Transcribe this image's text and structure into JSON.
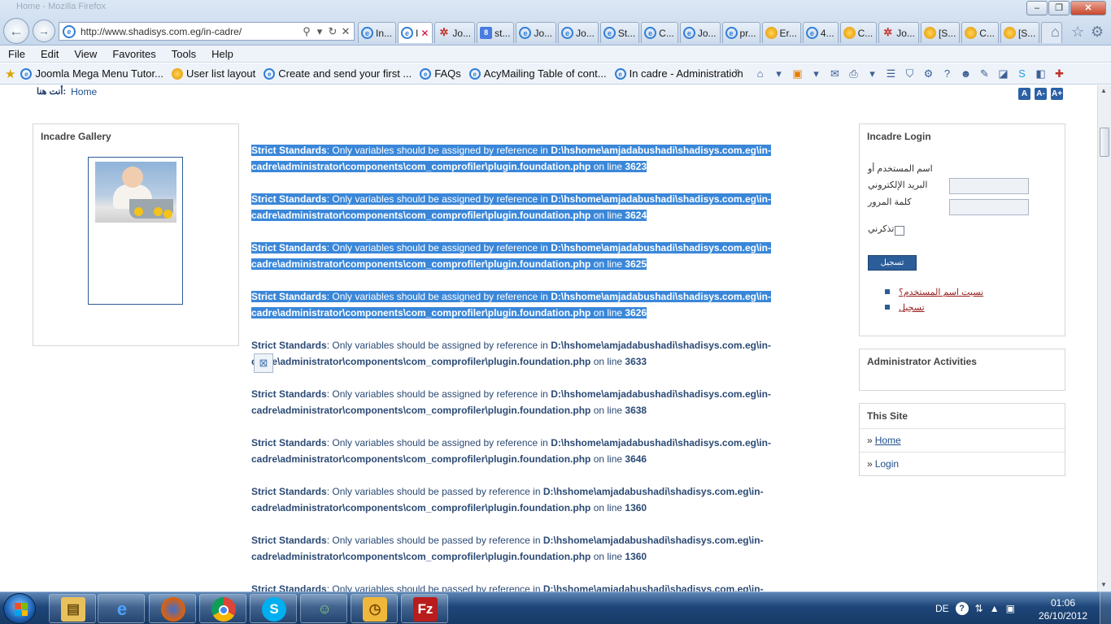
{
  "window": {
    "title": "Home - Mozilla Firefox"
  },
  "address_bar": {
    "url": "http://www.shadisys.com.eg/in-cadre/"
  },
  "tabs": [
    {
      "label": "In...",
      "icon": "ie",
      "active": false
    },
    {
      "label": "I",
      "icon": "ie",
      "active": true
    },
    {
      "label": "Jo...",
      "icon": "joomla",
      "active": false
    },
    {
      "label": "st...",
      "icon": "google",
      "active": false
    },
    {
      "label": "Jo...",
      "icon": "ie",
      "active": false
    },
    {
      "label": "Jo...",
      "icon": "ie",
      "active": false
    },
    {
      "label": "St...",
      "icon": "ie",
      "active": false
    },
    {
      "label": "C...",
      "icon": "ie",
      "active": false
    },
    {
      "label": "Jo...",
      "icon": "ie",
      "active": false
    },
    {
      "label": "pr...",
      "icon": "ie",
      "active": false
    },
    {
      "label": "Er...",
      "icon": "yellow",
      "active": false
    },
    {
      "label": "4...",
      "icon": "ie",
      "active": false
    },
    {
      "label": "C...",
      "icon": "yellow",
      "active": false
    },
    {
      "label": "Jo...",
      "icon": "joomla",
      "active": false
    },
    {
      "label": "[S...",
      "icon": "yellow",
      "active": false
    },
    {
      "label": "C...",
      "icon": "yellow",
      "active": false
    },
    {
      "label": "[S...",
      "icon": "yellow",
      "active": false
    }
  ],
  "menu": [
    "File",
    "Edit",
    "View",
    "Favorites",
    "Tools",
    "Help"
  ],
  "favorites": [
    {
      "label": "Joomla Mega Menu Tutor...",
      "icon": "ie"
    },
    {
      "label": "User list layout",
      "icon": "yellow"
    },
    {
      "label": "Create and send your first ...",
      "icon": "ie"
    },
    {
      "label": "FAQs",
      "icon": "ie"
    },
    {
      "label": "AcyMailing  Table of cont...",
      "icon": "ie"
    },
    {
      "label": "In cadre - Administration",
      "icon": "ie"
    }
  ],
  "favorites_overflow": "»",
  "page": {
    "breadcrumb_label": "أنت هنا:",
    "breadcrumb_home": "Home",
    "font_buttons": [
      "A",
      "A-",
      "A+"
    ],
    "gallery_title": "Incadre Gallery",
    "notices": [
      {
        "type": "Strict Standards",
        "message": ": Only variables should be assigned by reference in ",
        "path": "D:\\hshome\\amjadabushadi\\shadisys.com.eg\\in-cadre\\administrator\\components\\com_comprofiler\\plugin.foundation.php",
        "line_text": " on line ",
        "line": "3623",
        "selected": true
      },
      {
        "type": "Strict Standards",
        "message": ": Only variables should be assigned by reference in ",
        "path": "D:\\hshome\\amjadabushadi\\shadisys.com.eg\\in-cadre\\administrator\\components\\com_comprofiler\\plugin.foundation.php",
        "line_text": " on line ",
        "line": "3624",
        "selected": true
      },
      {
        "type": "Strict Standards",
        "message": ": Only variables should be assigned by reference in ",
        "path": "D:\\hshome\\amjadabushadi\\shadisys.com.eg\\in-cadre\\administrator\\components\\com_comprofiler\\plugin.foundation.php",
        "line_text": " on line ",
        "line": "3625",
        "selected": true
      },
      {
        "type": "Strict Standards",
        "message": ": Only variables should be assigned by reference in ",
        "path": "D:\\hshome\\amjadabushadi\\shadisys.com.eg\\in-cadre\\administrator\\components\\com_comprofiler\\plugin.foundation.php",
        "line_text": " on line ",
        "line": "3626",
        "selected": true
      },
      {
        "type": "Strict Standards",
        "message": ": Only variables should be assigned by reference in ",
        "path": "D:\\hshome\\amjadabushadi\\shadisys.com.eg\\in-cadre\\administrator\\components\\com_comprofiler\\plugin.foundation.php",
        "line_text": " on line ",
        "line": "3633",
        "selected": false
      },
      {
        "type": "Strict Standards",
        "message": ": Only variables should be assigned by reference in ",
        "path": "D:\\hshome\\amjadabushadi\\shadisys.com.eg\\in-cadre\\administrator\\components\\com_comprofiler\\plugin.foundation.php",
        "line_text": " on line ",
        "line": "3638",
        "selected": false
      },
      {
        "type": "Strict Standards",
        "message": ": Only variables should be assigned by reference in ",
        "path": "D:\\hshome\\amjadabushadi\\shadisys.com.eg\\in-cadre\\administrator\\components\\com_comprofiler\\plugin.foundation.php",
        "line_text": " on line ",
        "line": "3646",
        "selected": false
      },
      {
        "type": "Strict Standards",
        "message": ": Only variables should be passed by reference in ",
        "path": "D:\\hshome\\amjadabushadi\\shadisys.com.eg\\in-cadre\\administrator\\components\\com_comprofiler\\plugin.foundation.php",
        "line_text": " on line ",
        "line": "1360",
        "selected": false
      },
      {
        "type": "Strict Standards",
        "message": ": Only variables should be passed by reference in ",
        "path": "D:\\hshome\\amjadabushadi\\shadisys.com.eg\\in-cadre\\administrator\\components\\com_comprofiler\\plugin.foundation.php",
        "line_text": " on line ",
        "line": "1360",
        "selected": false
      },
      {
        "type": "Strict Standards",
        "message": ": Only variables should be passed by reference in ",
        "path": "D:\\hshome\\amjadabushadi\\shadisys.com.eg\\in-",
        "line_text": "",
        "line": "",
        "selected": false
      }
    ],
    "login": {
      "title": "Incadre Login",
      "username_label": "اسم المستخدم أو البريد الإلكتروني",
      "password_label": "كلمة المرور",
      "remember_label": "تذكرني",
      "submit_label": "تسجيل الدخول",
      "links": [
        "نسيت اسم المستخدم؟",
        "تسجيل"
      ]
    },
    "admin_activities_title": "Administrator Activities",
    "this_site": {
      "title": "This Site",
      "links": [
        "Home",
        "Login"
      ]
    }
  },
  "taskbar": {
    "apps": [
      "explorer",
      "internet-explorer",
      "firefox",
      "chrome",
      "skype",
      "contacts",
      "outlook",
      "filezilla"
    ],
    "language": "DE",
    "time": "01:06",
    "date": "26/10/2012"
  }
}
